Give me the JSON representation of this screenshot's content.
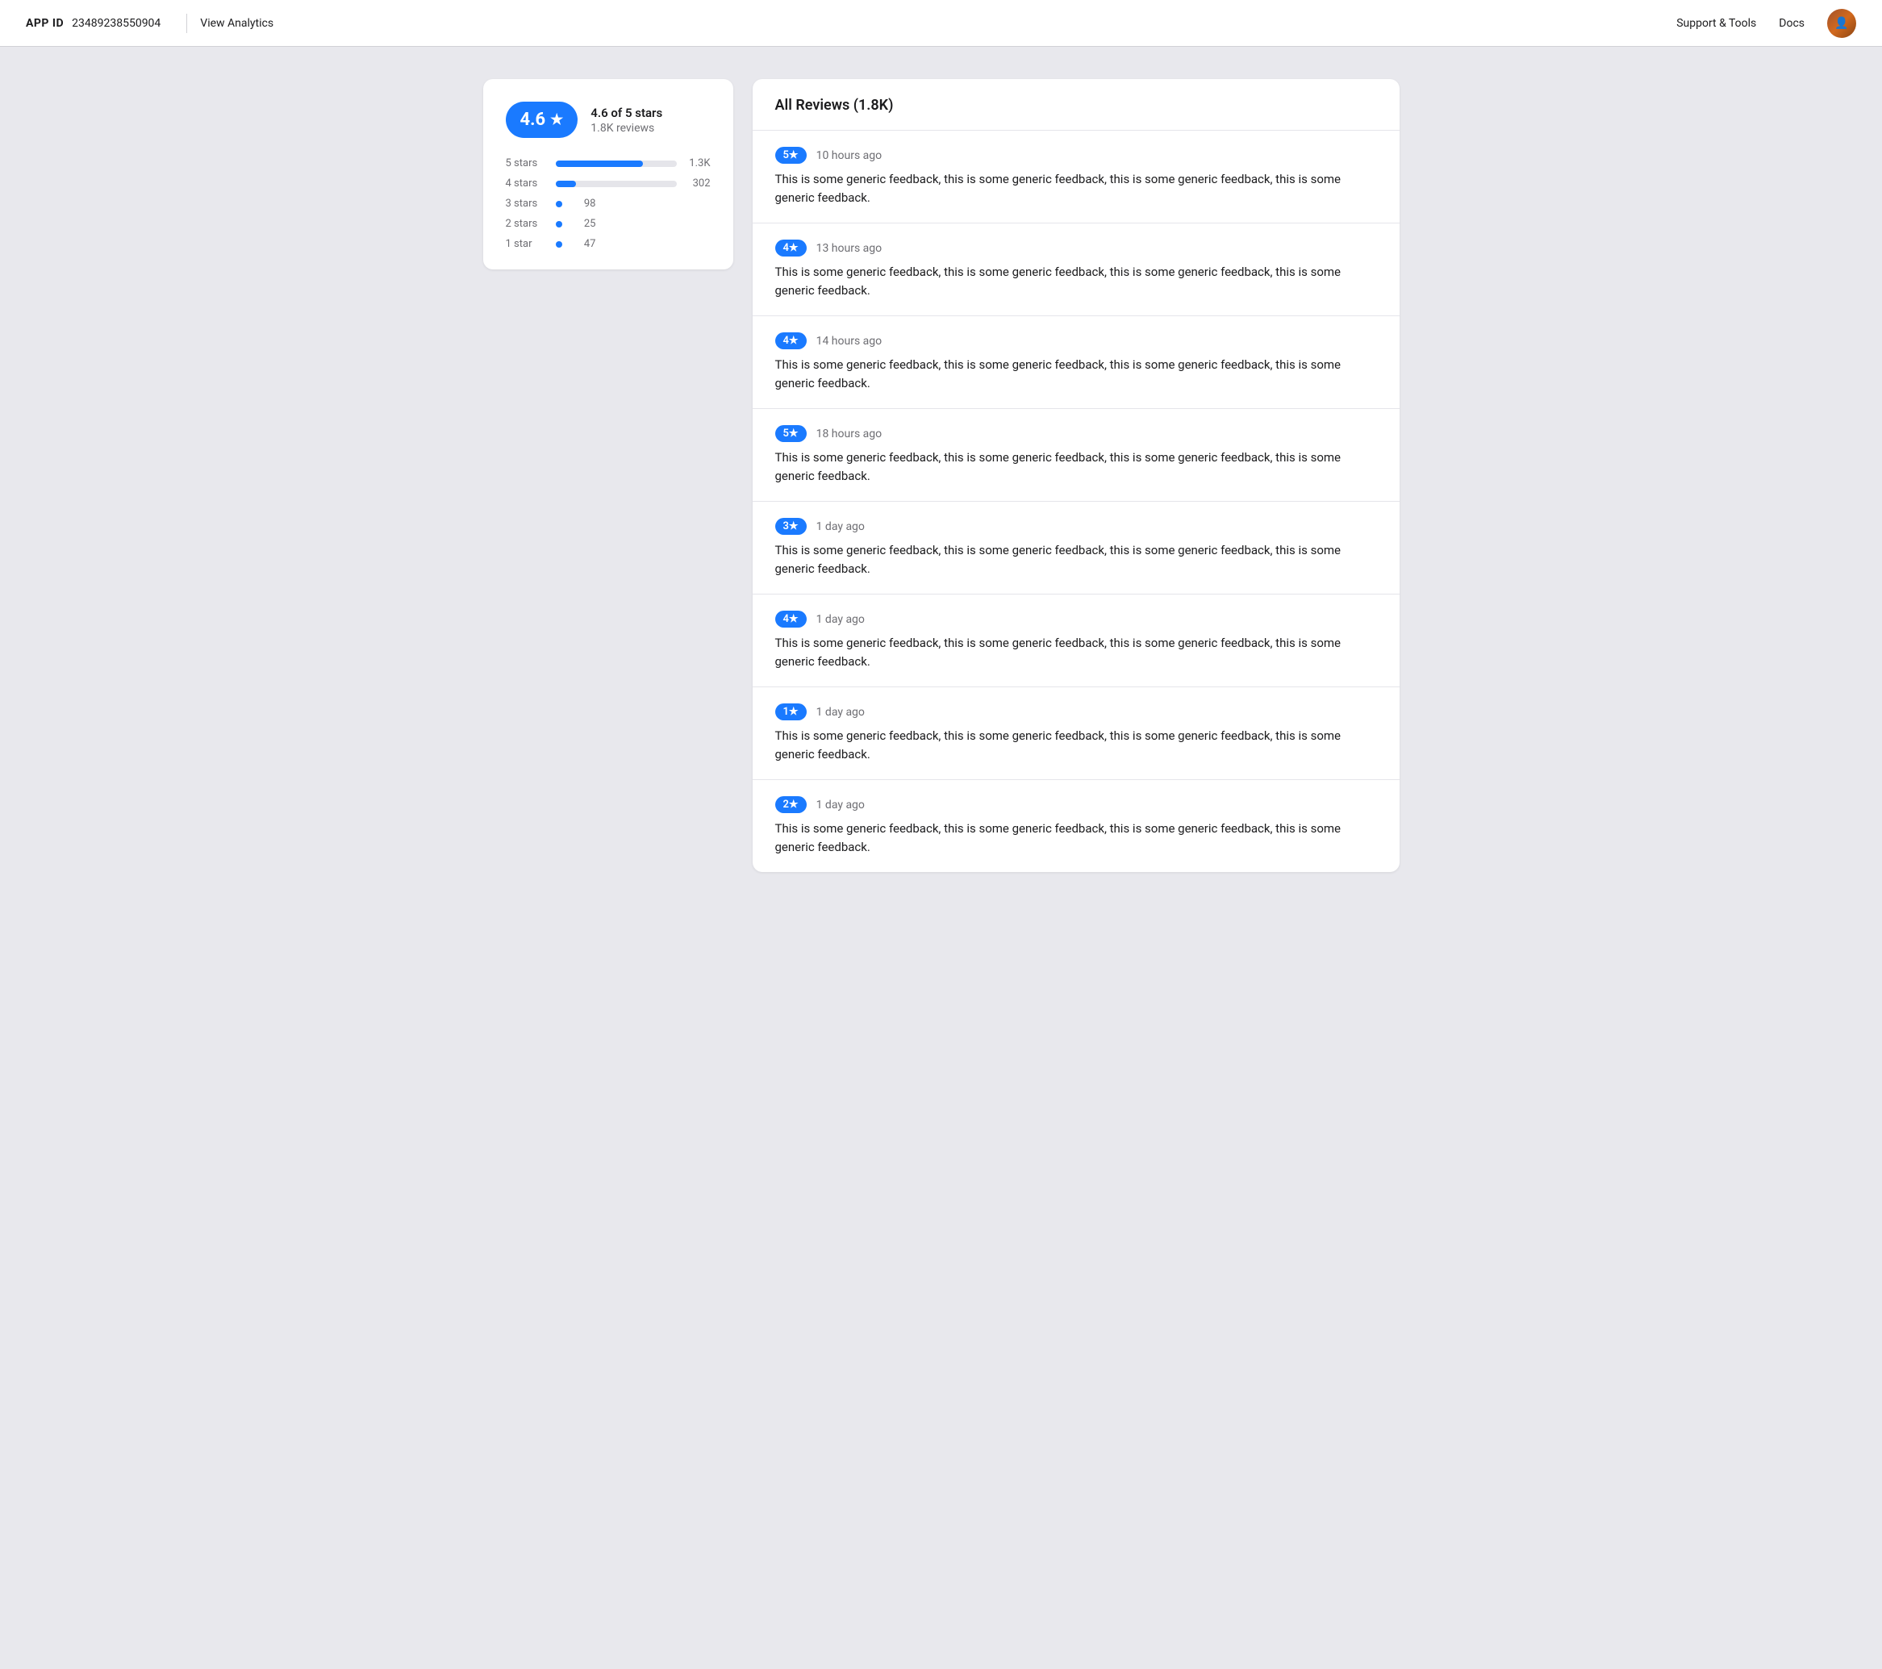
{
  "header": {
    "app_id_label": "APP ID",
    "app_id_value": "23489238550904",
    "view_analytics": "View Analytics",
    "support_tools": "Support & Tools",
    "docs": "Docs"
  },
  "rating": {
    "score": "4.6",
    "star_symbol": "★",
    "of_5_label": "4.6 of 5 stars",
    "review_count": "1.8K reviews",
    "bars": [
      {
        "label": "5 stars",
        "count": "1.3K",
        "pct": 72,
        "show_bar": true
      },
      {
        "label": "4 stars",
        "count": "302",
        "pct": 17,
        "show_bar": true
      },
      {
        "label": "3 stars",
        "count": "98",
        "pct": 0,
        "show_bar": false
      },
      {
        "label": "2 stars",
        "count": "25",
        "pct": 0,
        "show_bar": false
      },
      {
        "label": "1 star",
        "count": "47",
        "pct": 0,
        "show_bar": false
      }
    ]
  },
  "reviews": {
    "title": "All Reviews (1.8K)",
    "items": [
      {
        "stars": "5★",
        "time": "10 hours ago",
        "text": "This is some generic feedback, this is some generic feedback, this is some generic feedback, this is some generic feedback."
      },
      {
        "stars": "4★",
        "time": "13 hours ago",
        "text": "This is some generic feedback, this is some generic feedback, this is some generic feedback, this is some generic feedback."
      },
      {
        "stars": "4★",
        "time": "14 hours ago",
        "text": "This is some generic feedback, this is some generic feedback, this is some generic feedback, this is some generic feedback."
      },
      {
        "stars": "5★",
        "time": "18 hours ago",
        "text": "This is some generic feedback, this is some generic feedback, this is some generic feedback, this is some generic feedback."
      },
      {
        "stars": "3★",
        "time": "1 day ago",
        "text": "This is some generic feedback, this is some generic feedback, this is some generic feedback, this is some generic feedback."
      },
      {
        "stars": "4★",
        "time": "1 day ago",
        "text": "This is some generic feedback, this is some generic feedback, this is some generic feedback, this is some generic feedback."
      },
      {
        "stars": "1★",
        "time": "1 day ago",
        "text": "This is some generic feedback, this is some generic feedback, this is some generic feedback, this is some generic feedback."
      },
      {
        "stars": "2★",
        "time": "1 day ago",
        "text": "This is some generic feedback, this is some generic feedback, this is some generic feedback, this is some generic feedback."
      }
    ]
  }
}
